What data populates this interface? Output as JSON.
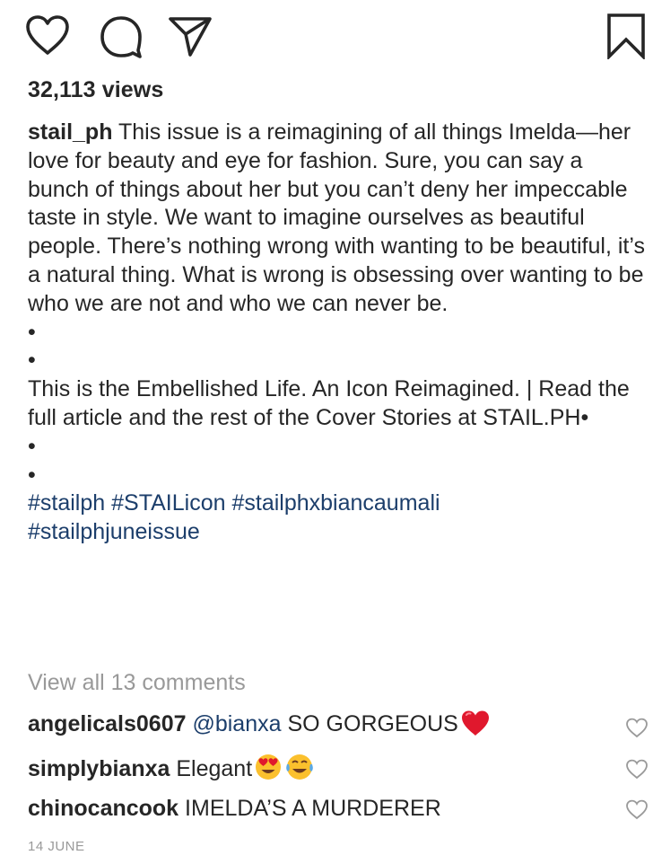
{
  "actions": {
    "like_icon": "heart-icon",
    "comment_icon": "comment-bubble-icon",
    "share_icon": "paper-plane-icon",
    "save_icon": "bookmark-icon"
  },
  "views": "32,113 views",
  "caption": {
    "username": "stail_ph",
    "paragraph1": "This issue is a reimagining of all things Imelda—her love for beauty and eye for fashion. Sure, you can say a bunch of things about her but you can’t deny her impeccable taste in style. We want to imagine ourselves as beautiful people. There’s nothing wrong with wanting to be beautiful, it’s a natural thing. What is wrong is obsessing over wanting to be who we are not and who we can never be.",
    "bullet": "•",
    "paragraph2": "This is the Embellished Life. An Icon Reimagined. | Read the full article and the rest of the Cover Stories at STAIL.PH•",
    "hashtags": [
      "#stailph",
      "#STAILicon",
      "#stailphxbiancaumali",
      "#stailphjuneissue"
    ]
  },
  "view_all_comments": "View all 13 comments",
  "comments": [
    {
      "username": "angelicals0607",
      "mention": "@bianxa",
      "text": "SO GORGEOUS",
      "emoji": [
        "red-heart"
      ]
    },
    {
      "username": "simplybianxa",
      "mention": "",
      "text": "Elegant",
      "emoji": [
        "heart-eyes",
        "tears-of-joy"
      ]
    },
    {
      "username": "chinocancook",
      "mention": "",
      "text": "IMELDA’S A MURDERER",
      "emoji": []
    }
  ],
  "date": "14 JUNE",
  "colors": {
    "text": "#262626",
    "link": "#1c3e6b",
    "muted": "#999999",
    "heart": "#e0182d",
    "emoji_yellow": "#fbc02d"
  }
}
